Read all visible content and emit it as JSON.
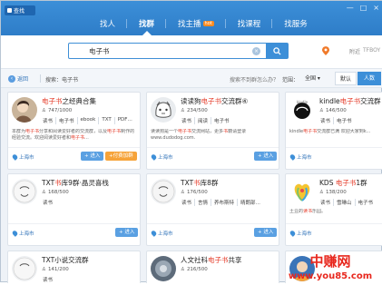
{
  "app": {
    "badge": "查找"
  },
  "window_controls": [
    "—",
    "□",
    "×"
  ],
  "nav": {
    "tabs": [
      {
        "label": "找人",
        "active": false
      },
      {
        "label": "找群",
        "active": true
      },
      {
        "label": "找主播",
        "active": false,
        "badge": "hot"
      },
      {
        "label": "找课程",
        "active": false
      },
      {
        "label": "找服务",
        "active": false
      }
    ]
  },
  "search": {
    "value": "电子书",
    "location": "附近",
    "location2": "TFBOY"
  },
  "filter": {
    "back": "返回",
    "query": "搜索：电子书",
    "hint": "搜索不到群怎么办？",
    "scope_label": "范围：",
    "scope_value": "全国",
    "sort_default": "默认",
    "sort_active": "人数"
  },
  "cards": [
    {
      "title_pre": "",
      "title_hl": "电子书",
      "title_post": "之经典合集",
      "members": "747/1000",
      "tags": [
        "读书",
        "电子书",
        "ebook",
        "TXT",
        "PDF…"
      ],
      "desc_parts": [
        "本群为",
        "电子书",
        "分享和阅读爱好者的交流群，以及",
        "电子书",
        "制作的经验交流。欢迎阅读爱好者和",
        "电子书",
        "..."
      ],
      "city": "上海市",
      "join": "+ 进入",
      "pay": "+付费加群"
    },
    {
      "title_pre": "读读狗",
      "title_hl": "电子书",
      "title_post": "交流群④",
      "members": "234/500",
      "tags": [
        "读书",
        "阅读",
        "电子书"
      ],
      "desc_parts": [
        "读读狗是一个",
        "电子书",
        "交流网站，更多",
        "书",
        "籍请登录www.dudodog.com."
      ],
      "city": "上海市",
      "join": "+ 进入",
      "pay": ""
    },
    {
      "title_pre": "kindle",
      "title_hl": "电子书",
      "title_post": "交流群",
      "members": "146/500",
      "tags": [
        "读书",
        "电子书"
      ],
      "desc_parts": [
        "kindle",
        "电子书",
        "交流群已满 欢迎大家到k..."
      ],
      "city": "上海市",
      "join": "",
      "pay": ""
    },
    {
      "title_pre": "TXT",
      "title_hl": "书",
      "title_post": "库9群·晶灵喜栈",
      "members": "168/500",
      "tags": [
        "读书"
      ],
      "desc_parts": [],
      "city": "上海市",
      "join": "+ 进入",
      "pay": ""
    },
    {
      "title_pre": "TXT",
      "title_hl": "书",
      "title_post": "库8群",
      "members": "176/500",
      "tags": [
        "读书",
        "言情",
        "养布斯特",
        "晴朗部…"
      ],
      "desc_parts": [],
      "city": "上海市",
      "join": "+ 进入",
      "pay": ""
    },
    {
      "title_pre": "KDS ",
      "title_hl": "电子书",
      "title_post": "1群",
      "members": "138/200",
      "tags": [
        "读书",
        "雪琳山",
        "电子书"
      ],
      "desc_parts": [
        "土豆的",
        "读书",
        "乐园。"
      ],
      "city": "上海市",
      "join": "",
      "pay": ""
    },
    {
      "title_pre": "TXT小说交流群",
      "title_hl": "",
      "title_post": "",
      "members": "141/200",
      "tags": [
        "读书"
      ],
      "desc_parts": [],
      "city": "",
      "join": "",
      "pay": ""
    },
    {
      "title_pre": "人文社科",
      "title_hl": "电子书",
      "title_post": "共享",
      "members": "216/500",
      "tags": [],
      "desc_parts": [],
      "city": "",
      "join": "",
      "pay": ""
    },
    {
      "title_pre": "",
      "title_hl": "",
      "title_post": "",
      "members": "",
      "tags": [],
      "desc_parts": [],
      "city": "",
      "join": "",
      "pay": ""
    }
  ],
  "watermark": {
    "line1": "中赚网",
    "line2": "www.you85.com"
  },
  "colors": {
    "nav": "#2e7dc8",
    "highlight": "#e53c2a",
    "link": "#2f72b8",
    "orange": "#f6a339"
  }
}
